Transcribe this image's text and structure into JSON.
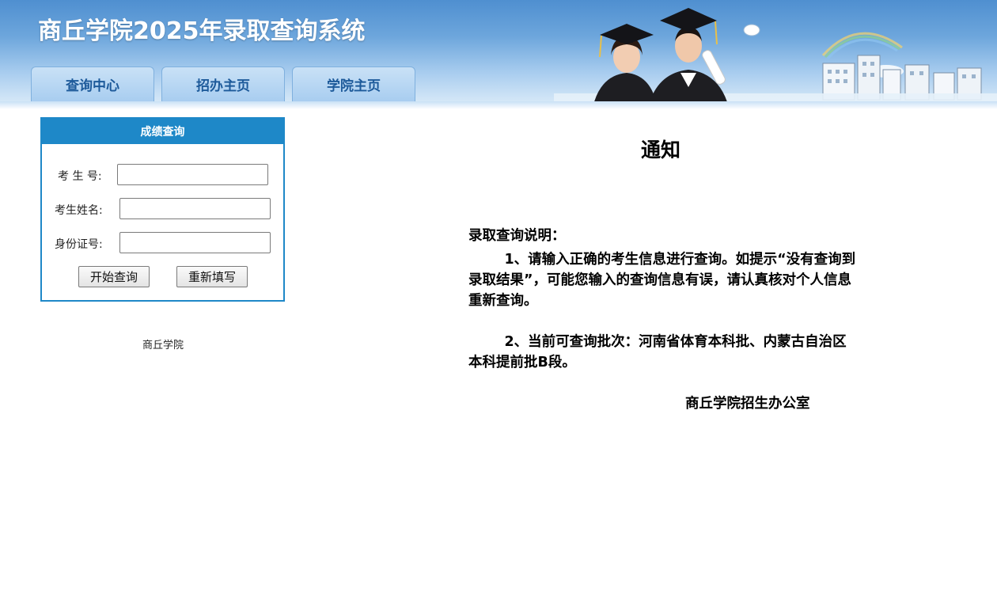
{
  "header": {
    "title": "商丘学院2025年录取查询系统",
    "nav_tabs": [
      {
        "label": "查询中心"
      },
      {
        "label": "招办主页"
      },
      {
        "label": "学院主页"
      }
    ]
  },
  "query_panel": {
    "title": "成绩查询",
    "fields": [
      {
        "label": "考 生 号:",
        "value": ""
      },
      {
        "label": "考生姓名:",
        "value": ""
      },
      {
        "label": "身份证号:",
        "value": ""
      }
    ],
    "buttons": {
      "submit": "开始查询",
      "reset": "重新填写"
    }
  },
  "footer": {
    "college_name": "商丘学院"
  },
  "notice": {
    "title": "通知",
    "heading": "录取查询说明：",
    "paragraphs": [
      "1、请输入正确的考生信息进行查询。如提示“没有查询到录取结果”，可能您输入的查询信息有误，请认真核对个人信息重新查询。",
      "2、当前可查询批次：河南省体育本科批、内蒙古自治区本科提前批B段。"
    ],
    "signature": "商丘学院招生办公室"
  },
  "colors": {
    "header_blue": "#4f8fd0",
    "panel_blue": "#1e88c8",
    "tab_text": "#1d5a9a"
  }
}
